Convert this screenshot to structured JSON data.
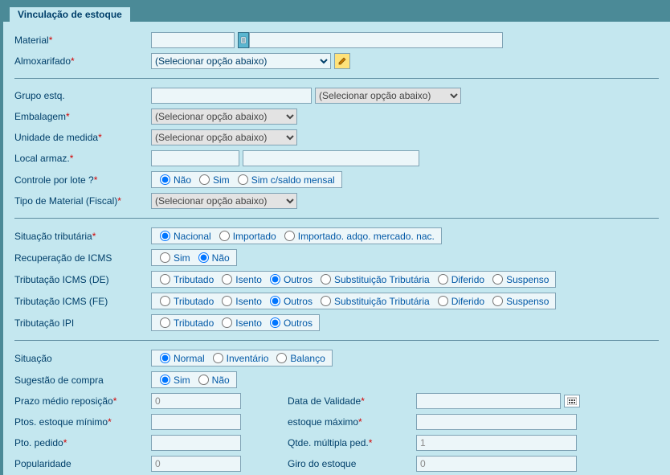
{
  "tab": {
    "title": "Vinculação de estoque"
  },
  "labels": {
    "material": "Material",
    "almox": "Almoxarifado",
    "grupo": "Grupo estq.",
    "embalagem": "Embalagem",
    "unidade": "Unidade de medida",
    "local": "Local armaz.",
    "controle": "Controle por lote ?",
    "tipo_fiscal": "Tipo de Material (Fiscal)",
    "sit_trib": "Situação tributária",
    "recup_icms": "Recuperação de ICMS",
    "trib_de": "Tributação ICMS (DE)",
    "trib_fe": "Tributação ICMS (FE)",
    "trib_ipi": "Tributação IPI",
    "situacao": "Situação",
    "sugestao": "Sugestão de compra",
    "prazo": "Prazo médio reposição",
    "data_val": "Data de Validade",
    "pto_min": "Ptos. estoque mínimo",
    "est_max": "estoque máximo",
    "pto_ped": "Pto. pedido",
    "qtde_mult": "Qtde. múltipla ped.",
    "popular": "Popularidade",
    "giro": "Giro do estoque"
  },
  "select_placeholder": "(Selecionar opção abaixo)",
  "radios": {
    "nao": "Não",
    "sim": "Sim",
    "sim_saldo": "Sim c/saldo mensal",
    "nacional": "Nacional",
    "importado": "Importado",
    "imp_adq": "Importado. adqo. mercado. nac.",
    "tributado": "Tributado",
    "isento": "Isento",
    "outros": "Outros",
    "sub_trib": "Substituição Tributária",
    "diferido": "Diferido",
    "suspenso": "Suspenso",
    "normal": "Normal",
    "inventario": "Inventário",
    "balanco": "Balanço"
  },
  "values": {
    "prazo": "0",
    "qtde_mult": "1",
    "popular": "0",
    "giro": "0",
    "material1": "",
    "material2": "",
    "grupo": "",
    "local1": "",
    "local2": "",
    "pto_min": "",
    "est_max": "",
    "pto_ped": "",
    "data_val": ""
  }
}
